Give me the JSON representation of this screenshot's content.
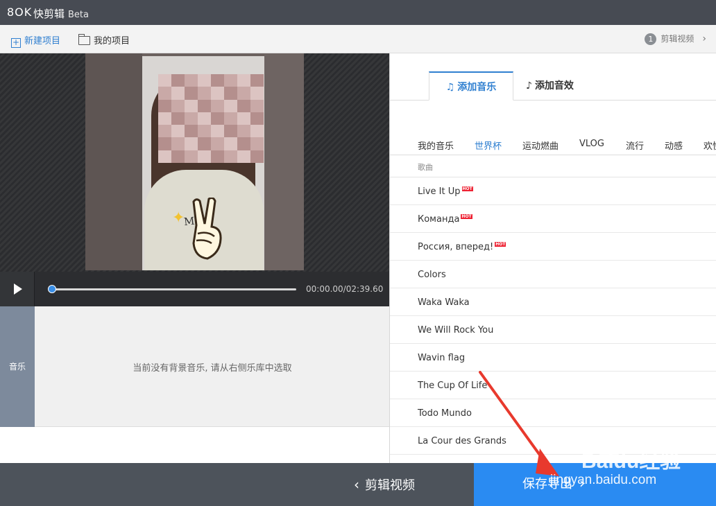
{
  "titlebar": {
    "logo": "8OK",
    "app_name": "快剪辑",
    "badge": "Beta"
  },
  "toolbar": {
    "new_project": "新建项目",
    "my_projects": "我的项目",
    "step_number": "1",
    "step_label": "剪辑视频"
  },
  "player": {
    "time": "00:00.00/02:39.60",
    "progress": 0.0,
    "shirt_text": "Marti"
  },
  "music_track": {
    "label": "音乐",
    "empty_message": "当前没有背景音乐, 请从右侧乐库中选取"
  },
  "tabs": [
    {
      "label": "添加音乐",
      "active": true
    },
    {
      "label": "添加音效",
      "active": false
    }
  ],
  "categories": [
    {
      "label": "我的音乐",
      "active": false
    },
    {
      "label": "世界杯",
      "active": true
    },
    {
      "label": "运动燃曲",
      "active": false
    },
    {
      "label": "VLOG",
      "active": false
    },
    {
      "label": "流行",
      "active": false
    },
    {
      "label": "动感",
      "active": false
    },
    {
      "label": "欢快",
      "active": false
    }
  ],
  "song_header": "歌曲",
  "hot_label": "HOT",
  "songs": [
    {
      "title": "Live It Up",
      "hot": true
    },
    {
      "title": "Команда",
      "hot": true
    },
    {
      "title": "Россия, вперед!",
      "hot": true
    },
    {
      "title": "Colors",
      "hot": false
    },
    {
      "title": "Waka Waka",
      "hot": false
    },
    {
      "title": "We Will Rock You",
      "hot": false
    },
    {
      "title": "Wavin flag",
      "hot": false
    },
    {
      "title": "The Cup Of Life",
      "hot": false
    },
    {
      "title": "Todo Mundo",
      "hot": false
    },
    {
      "title": "La Cour des Grands",
      "hot": false
    }
  ],
  "bottom": {
    "back_label": "剪辑视频",
    "save_label": "保存导出"
  },
  "watermark": {
    "brand": "Baidu经验",
    "url": "jingyan.baidu.com"
  },
  "colors": {
    "accent": "#2f7fd0",
    "save_button": "#2a8bf2",
    "annotation_arrow": "#e8392d",
    "titlebar": "#474b53"
  }
}
